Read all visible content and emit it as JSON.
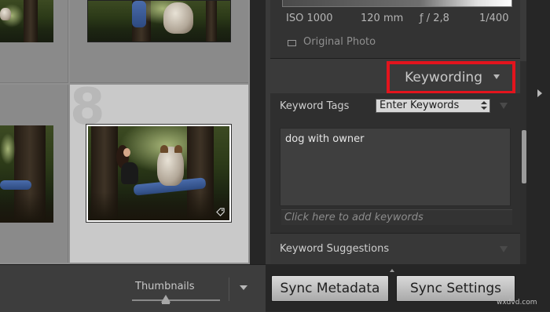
{
  "grid": {
    "selected_index_label": "8"
  },
  "toolbar": {
    "thumbnails_label": "Thumbnails",
    "thumbnail_size": 0.4
  },
  "metadata_panel": {
    "iso": "ISO 1000",
    "focal_length": "120 mm",
    "aperture": "ƒ / 2,8",
    "shutter": "1/400",
    "original_photo_label": "Original Photo"
  },
  "keywording": {
    "header": "Keywording",
    "keyword_tags_label": "Keyword Tags",
    "mode_select_value": "Enter Keywords",
    "keywords_text": "dog with owner",
    "add_placeholder": "Click here to add keywords",
    "suggestions_label": "Keyword Suggestions"
  },
  "sync": {
    "metadata_label": "Sync Metadata",
    "settings_label": "Sync Settings"
  },
  "watermark": "wxdvd.com",
  "colors": {
    "highlight": "#e3141d",
    "selected_cell": "#c9c9c9"
  }
}
